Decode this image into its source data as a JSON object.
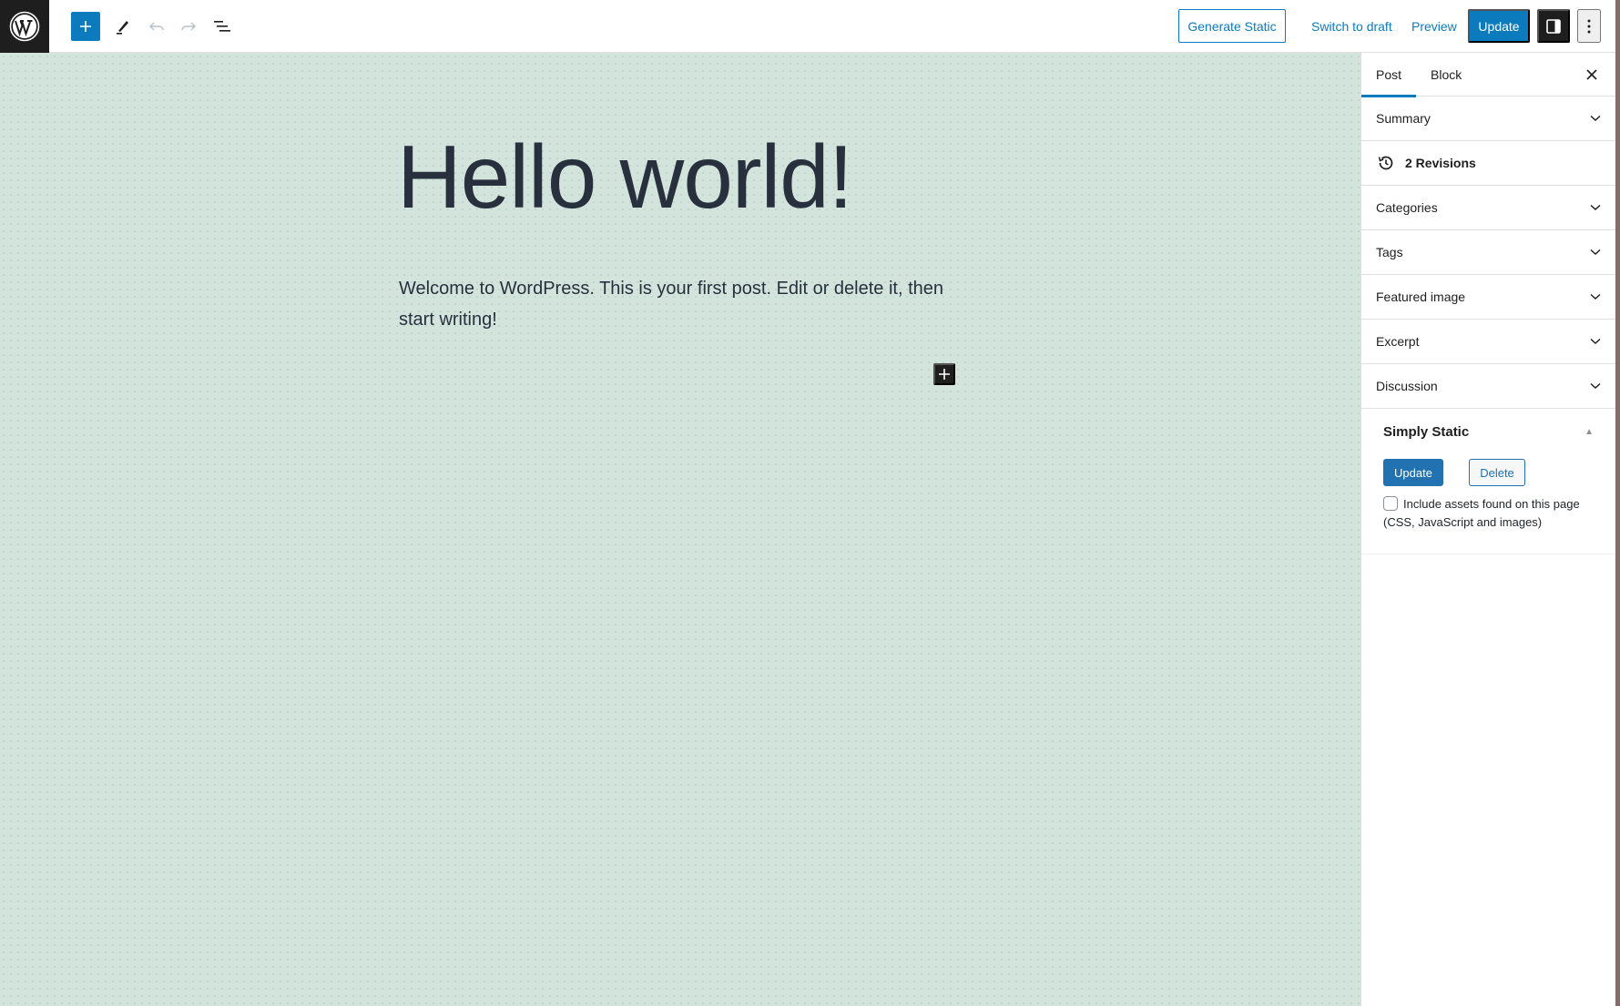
{
  "header": {
    "logo": "wordpress-logo",
    "toolbar": {
      "inserter": "plus-icon",
      "tools": "pencil-icon",
      "undo": "undo-icon",
      "redo": "redo-icon",
      "list_view": "list-view-icon"
    },
    "generate_static_label": "Generate Static",
    "switch_to_draft_label": "Switch to draft",
    "preview_label": "Preview",
    "update_label": "Update",
    "settings_icon": "sidebar-toggle-icon",
    "more_icon": "more-vertical-icon"
  },
  "colors": {
    "accent": "#0c7bbd",
    "canvas_bg": "#d2e4dc",
    "dark": "#1e1e1e",
    "text": "#28303d"
  },
  "post": {
    "title": "Hello world!",
    "body": "Welcome to WordPress. This is your first post. Edit or delete it, then start writing!"
  },
  "sidebar": {
    "tabs": [
      {
        "label": "Post",
        "active": true
      },
      {
        "label": "Block",
        "active": false
      }
    ],
    "panels": [
      {
        "label": "Summary"
      },
      {
        "label": "2 Revisions"
      },
      {
        "label": "Categories"
      },
      {
        "label": "Tags"
      },
      {
        "label": "Featured image"
      },
      {
        "label": "Excerpt"
      },
      {
        "label": "Discussion"
      }
    ],
    "simply_static": {
      "title": "Simply Static",
      "update_label": "Update",
      "delete_label": "Delete",
      "checkbox_label": "Include assets found on this page (CSS, JavaScript and images)",
      "checkbox_checked": false
    }
  }
}
